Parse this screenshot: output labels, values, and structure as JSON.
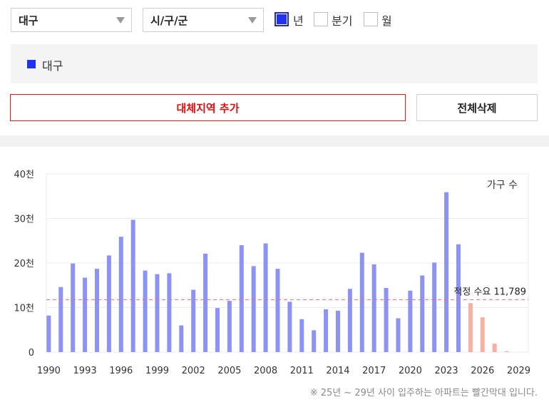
{
  "filters": {
    "region_select": "대구",
    "district_select": "시/구/군",
    "period_options": [
      {
        "label": "년",
        "checked": true
      },
      {
        "label": "분기",
        "checked": false
      },
      {
        "label": "월",
        "checked": false
      }
    ]
  },
  "legend": {
    "label": "대구",
    "color": "#2233ee"
  },
  "buttons": {
    "add_region": "대체지역 추가",
    "delete_all": "전체삭제"
  },
  "chart_data": {
    "type": "bar",
    "series_label": "가구 수",
    "y_ticks": [
      "0",
      "10천",
      "20천",
      "30천",
      "40천"
    ],
    "ylim": [
      0,
      40000
    ],
    "x_ticks": [
      "1990",
      "1993",
      "1996",
      "1999",
      "2002",
      "2005",
      "2008",
      "2011",
      "2014",
      "2017",
      "2020",
      "2023",
      "2026",
      "2029"
    ],
    "categories": [
      1990,
      1991,
      1992,
      1993,
      1994,
      1995,
      1996,
      1997,
      1998,
      1999,
      2000,
      2001,
      2002,
      2003,
      2004,
      2005,
      2006,
      2007,
      2008,
      2009,
      2010,
      2011,
      2012,
      2013,
      2014,
      2015,
      2016,
      2017,
      2018,
      2019,
      2020,
      2021,
      2022,
      2023,
      2024,
      2025,
      2026,
      2027,
      2028
    ],
    "values": [
      8200,
      14600,
      19900,
      16700,
      18700,
      21700,
      25900,
      29700,
      18300,
      17500,
      17700,
      6000,
      14000,
      22100,
      9900,
      11500,
      24000,
      19300,
      24400,
      18700,
      11300,
      7400,
      4900,
      9600,
      9300,
      14200,
      22300,
      19700,
      14400,
      7600,
      13800,
      17200,
      20100,
      35900,
      24200,
      11000,
      7800,
      1900,
      200
    ],
    "highlight_from": 2025,
    "bar_color": "#8c93f5",
    "highlight_color": "#f8b0a4",
    "reference_line": {
      "value": 11789,
      "label": "적정 수요 11,789",
      "color": "#f07070"
    },
    "grid": true
  },
  "footnote": "※ 25년 ~ 29년 사이 입주하는 아파트는 빨간막대 입니다."
}
